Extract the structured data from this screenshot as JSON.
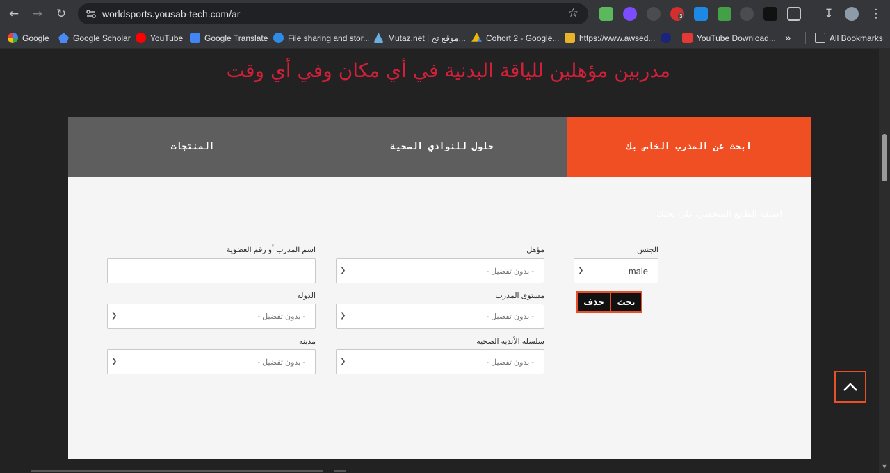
{
  "browser": {
    "url": "worldsports.yousab-tech.com/ar",
    "bookmarks": [
      {
        "label": "Google",
        "color": "#4285f4"
      },
      {
        "label": "Google Scholar",
        "color": "#4a8af4"
      },
      {
        "label": "YouTube",
        "color": "#ff0000"
      },
      {
        "label": "Google Translate",
        "color": "#4285f4"
      },
      {
        "label": "File sharing and stor...",
        "color": "#2f8ce6"
      },
      {
        "label": "Mutaz.net | موقع تح...",
        "color": "#6ab0de"
      },
      {
        "label": "Cohort 2 - Google...",
        "color": "#f4b400"
      },
      {
        "label": "https://www.awsed...",
        "color": "#e8b32a"
      },
      {
        "label": "",
        "color": "#1a237e"
      },
      {
        "label": "YouTube Download...",
        "color": "#e53935"
      }
    ],
    "all_bookmarks": "All Bookmarks",
    "more_bookmarks": "»",
    "extension_badge": "3"
  },
  "page": {
    "hero_title": "مدربين مؤهلين للياقة البدنية في أي مكان وفي أي وقت",
    "tabs": [
      {
        "label": "ابحث عن المدرب الخاص بك",
        "active": true
      },
      {
        "label": "حلول للنوادي الصحية",
        "active": false
      },
      {
        "label": "المنتجات",
        "active": false
      }
    ],
    "panel_heading": "اضيفة الطابع الشخصي على بحثك",
    "form": {
      "gender_label": "الجنس",
      "gender_value": "male",
      "qualification_label": "مؤهل",
      "qualification_value": "- بدون تفضيل -",
      "name_label": "اسم المدرب أو رقم العضوية",
      "name_value": "",
      "level_label": "مستوى المدرب",
      "level_value": "- بدون تفضيل -",
      "country_label": "الدولة",
      "country_value": "- بدون تفضيل -",
      "chain_label": "سلسلة الأندية الصحية",
      "chain_value": "- بدون تفضيل -",
      "city_label": "مدينة",
      "city_value": "- بدون تفضيل -",
      "search_button": "بحث",
      "delete_button": "حذف"
    }
  },
  "colors": {
    "accent": "#f04e23",
    "title_red": "#d2203a",
    "tab_gray": "#5e5e5e",
    "page_bg": "#222222",
    "panel_bg": "#f5f5f5"
  }
}
